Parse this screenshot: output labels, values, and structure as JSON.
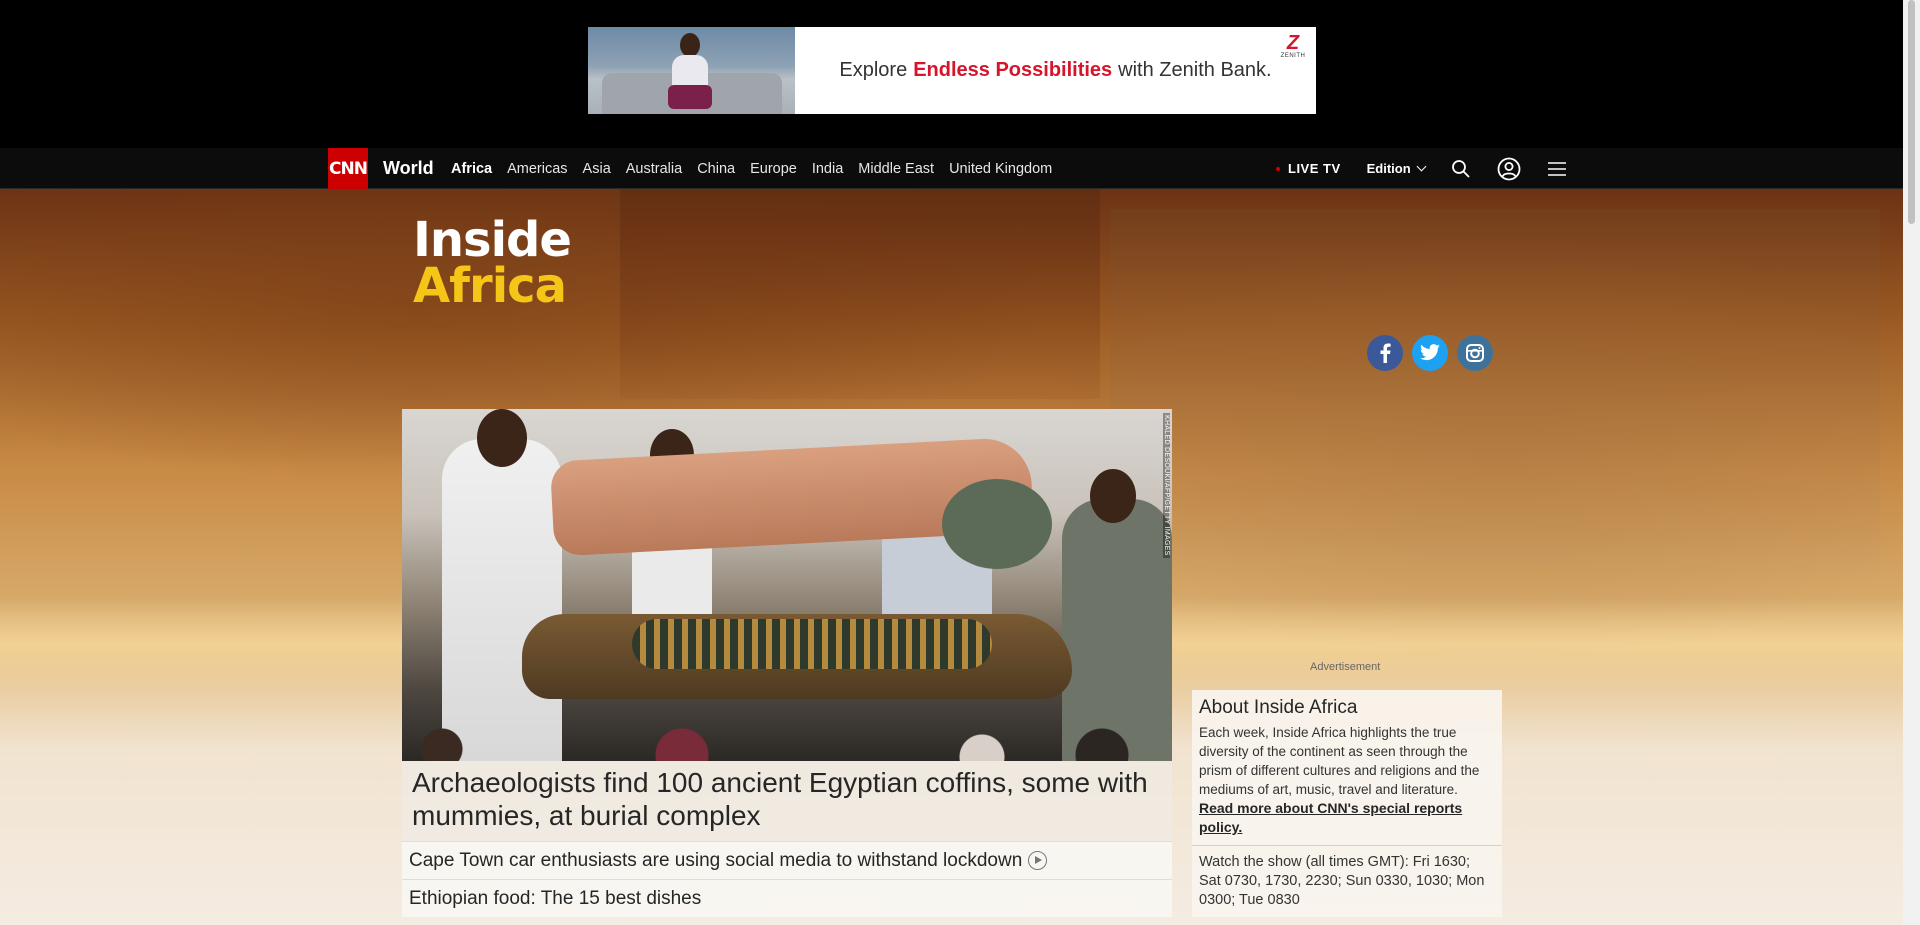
{
  "ad": {
    "text_before": "Explore",
    "text_highlight": "Endless Possibilities",
    "text_after": "with Zenith Bank.",
    "logo_letter": "Z",
    "logo_name": "ZENITH"
  },
  "nav": {
    "brand": "CNN",
    "section": "World",
    "links": [
      "Africa",
      "Americas",
      "Asia",
      "Australia",
      "China",
      "Europe",
      "India",
      "Middle East",
      "United Kingdom"
    ],
    "active_link": "Africa",
    "live_tv": "LIVE TV",
    "edition": "Edition"
  },
  "show": {
    "title_line1": "Inside",
    "title_line2": "Africa"
  },
  "social": {
    "icons": [
      "facebook-icon",
      "twitter-icon",
      "instagram-icon"
    ]
  },
  "hero": {
    "image_credit": "KHALED DESOUKI/AFP/GETTY IMAGES",
    "headline": "Archaeologists find 100 ancient Egyptian coffins, some with mummies, at burial complex"
  },
  "stories": [
    {
      "title": "Cape Town car enthusiasts are using social media to withstand lockdown",
      "has_video": true
    },
    {
      "title": "Ethiopian food: The 15 best dishes",
      "has_video": false
    }
  ],
  "sidebar": {
    "advertisement_label": "Advertisement",
    "about_title": "About Inside Africa",
    "about_text": "Each week, Inside Africa highlights the true diversity of the continent as seen through the prism of different cultures and religions and the mediums of art, music, travel and literature.",
    "read_more": "Read more about CNN's special reports policy.",
    "watch": "Watch the show (all times GMT): Fri 1630; Sat 0730, 1730, 2230; Sun 0330, 1030; Mon 0300; Tue 0830"
  },
  "colors": {
    "cnn_red": "#cc0000",
    "nav_bg": "#0c0c0c",
    "show_accent": "#f5c518",
    "ad_highlight": "#d7142b"
  }
}
